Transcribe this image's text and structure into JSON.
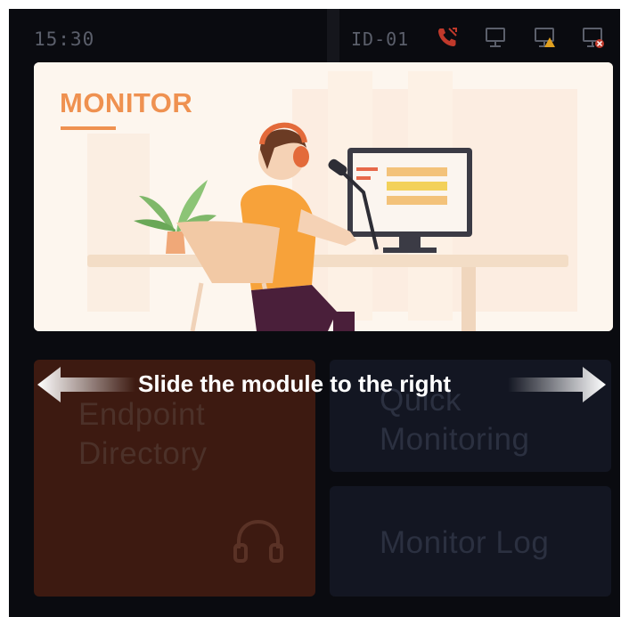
{
  "status": {
    "time": "15:30",
    "device_id": "ID-01"
  },
  "banner": {
    "title": "MONITOR"
  },
  "modules": {
    "endpoint_directory": "Endpoint Directory",
    "endpoint_directory_line1": "Endpoint",
    "endpoint_directory_line2": "Directory",
    "quick_monitoring_line1": "Quick",
    "quick_monitoring_line2": "Monitoring",
    "monitor_log": "Monitor Log"
  },
  "hint": {
    "text": "Slide the module to the right"
  },
  "icons": {
    "call": "phone-missed-icon",
    "monitor_ok": "monitor-icon",
    "monitor_warn": "monitor-warning-icon",
    "monitor_error": "monitor-error-icon",
    "headphones": "headphones-icon",
    "arrow_left": "arrow-left-icon",
    "arrow_right": "arrow-right-icon"
  },
  "colors": {
    "accent": "#ef9150",
    "call_icon": "#c0392b",
    "warning": "#e0a020",
    "error": "#c0392b",
    "background": "#0a0b10"
  }
}
